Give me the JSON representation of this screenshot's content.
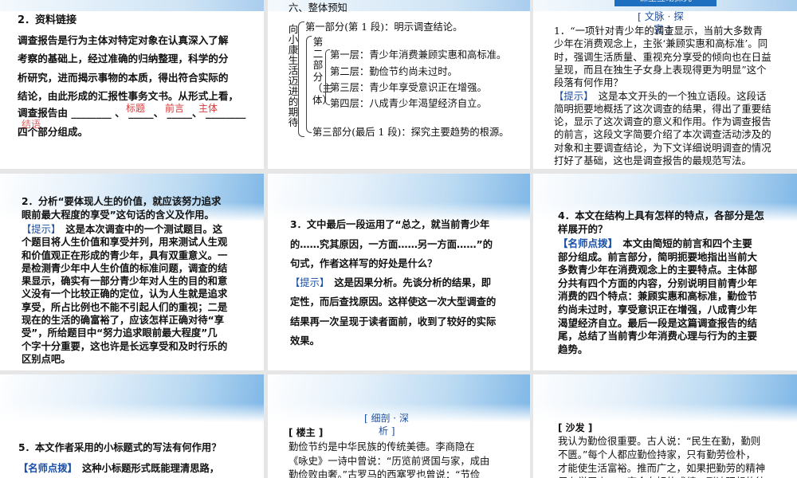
{
  "slide1": {
    "title": "2．资料链接",
    "lines": [
      "调查报告是行为主体对特定对象在认真深入了解",
      "考察的基础上，经过准确的归纳整理，科学的分",
      "析研究，进而揭示事物的本质，得出符合实际的",
      "结论，由此形成的汇报性事务文书。从形式上看，"
    ],
    "blank_line": "调查报告由 ________ 、 _____、 _____、 ________",
    "last_line": "四个部分组成。",
    "answers": [
      "标题",
      "前言",
      "主体",
      "结语"
    ]
  },
  "slide2": {
    "heading": "六、整体预知",
    "root": "向小康生活迈进的期待",
    "part1": "第一部分(第 1 段)：明示调查结论。",
    "part2": "第二部分（主体）",
    "layers": [
      "第一层：青少年消费兼顾实惠和高标准。",
      "第二层：勤俭节约尚未过时。",
      "第三层：青少年享受意识正在增强。",
      "第四层：八成青少年渴望经济自立。"
    ],
    "part3": "第三部分(最后 1 段)：探究主要趋势的根源。"
  },
  "slide3": {
    "banner": "课堂互动探究",
    "section_tag": [
      "[ 文脉 · 探",
      "究 ]"
    ],
    "question": [
      "1．“一项针对青少年的调查显示，当前大多数青",
      "少年在消费观念上，主张‘兼顾实惠和高标准’。同",
      "时，强调生活质量、重视充分享受的倾向也在日益",
      "呈现，而且在独生子女身上表现得更为明显”这个",
      "段落有何作用？"
    ],
    "hint": {
      "label": "【提示】",
      "lines": [
        "　这是本文开头的一个独立语段。这段话",
        "简明扼要地概括了这次调查的结果，得出了重要结",
        "论，显示了这次调查的意义和作用。作为调查报告",
        "的前言，这段文字简要介绍了本次调查活动涉及的",
        "对象和主要调查结论，为下文详细说明调查的情况",
        "打好了基础，这也是调查报告的最规范写法。"
      ]
    }
  },
  "slide4": {
    "question": [
      "2．分析“要体现人生的价值，就应该努力追求",
      "眼前最大程度的享受”这句话的含义及作用。"
    ],
    "hint": {
      "label": "【提示】",
      "lines": [
        "　这是本次调查中的一个测试题目。这",
        "个题目将人生价值和享受并列，用来测试人生观",
        "和价值观正在形成的青少年，具有双重意义。一",
        "是检测青少年中人生价值的标准问题，调查的结",
        "果显示，确实有一部分青少年对人生的目的和意",
        "义没有一个比较正确的定位，认为人生就是追求",
        "享受，所占比例也不能不引起人们的重视；二是",
        "现在的生活的确富裕了，应该怎样正确对待“享",
        "受”，所给题目中“努力追求眼前最大程度”几",
        "个字十分重要，这也许是长远享受和及时行乐的",
        "区别点吧。"
      ]
    }
  },
  "slide5": {
    "question": [
      "3．文中最后一段运用了“总之，就当前青少年",
      "的……究其原因，一方面……另一方面……”的",
      "句式，作者这样写的好处是什么？"
    ],
    "hint": {
      "label": "【提示】",
      "lines": [
        "　这是因果分析。先谈分析的结果，即",
        "定性，而后查找原因。这样使这一次大型调查的",
        "结果再一次呈现于读者面前，收到了较好的实际",
        "效果。"
      ]
    }
  },
  "slide6": {
    "question": [
      "4．本文在结构上具有怎样的特点，各部分是怎",
      "样展开的？"
    ],
    "hint": {
      "label": "【名师点拨】",
      "lines": [
        "　本文由简短的前言和四个主要",
        "部分组成。前言部分，简明扼要地指出当前大",
        "多数青少年在消费观念上的主要特点。主体部",
        "分共有四个方面的内容，分别说明目前青少年",
        "消费的四个特点：兼顾实惠和高标准，勤俭节",
        "约尚未过时，享受意识正在增强，八成青少年",
        "渴望经济自立。最后一段是这篇调查报告的结",
        "尾，总结了当前青少年消费心理与行为的主要",
        "趋势。"
      ]
    }
  },
  "slide7": {
    "question": "5．本文作者采用的小标题式的写法有何作用？",
    "hint": {
      "label": "【名师点拨】",
      "lines": [
        "　这种小标题形式既能理清思路，"
      ]
    }
  },
  "slide8": {
    "section_tag": [
      "[ 细剖 · 深",
      "析 ]"
    ],
    "speaker": "[ 楼主 ]",
    "lines": [
      "勤俭节约是中华民族的传统美德。李商隐在",
      "《咏史》一诗中曾说：“历览前贤国与家，成由",
      "勤俭败由奢。”古罗马的西塞罗也曾说：“节俭"
    ]
  },
  "slide9": {
    "speaker": "[ 沙发 ]",
    "lines": [
      "我认为勤俭很重要。古人说：“民生在勤，勤则",
      "不匮。”每个人都应勤俭持家，只有勤劳俭朴，",
      "才能使生活富裕。推而广之，如果把勤劳的精神",
      "用在学习上，一定会有好的成绩，到达理想的彼"
    ]
  },
  "colors": {
    "accent_blue": "#1b4fa6",
    "answer_red": "#d53a3a",
    "banner": "#1f6fc0"
  }
}
